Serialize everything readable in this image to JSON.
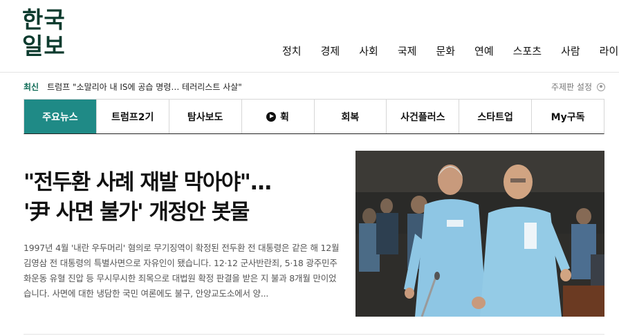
{
  "logo": {
    "line1": "한국",
    "line2": "일보"
  },
  "nav": {
    "items": [
      "정치",
      "경제",
      "사회",
      "국제",
      "문화",
      "연예",
      "스포츠",
      "사람",
      "라이"
    ]
  },
  "ticker": {
    "label": "최신",
    "headline": "트럼프 \"소말리아 내 IS에 공습 명령… 테러리스트 사살\""
  },
  "edition": {
    "label": "주제판 설정",
    "icon": "gear-icon"
  },
  "tabs": [
    {
      "label": "주요뉴스",
      "active": true
    },
    {
      "label": "트럼프2기"
    },
    {
      "label": "탐사보도"
    },
    {
      "label": "휙",
      "icon": "play-icon"
    },
    {
      "label": "회복"
    },
    {
      "label": "사건플러스"
    },
    {
      "label": "스타트업"
    },
    {
      "label": "My구독"
    }
  ],
  "article": {
    "headline_line1": "\"전두환 사례 재발 막아야\"...",
    "headline_line2": "'尹 사면 불가' 개정안 봇물",
    "summary": "1997년 4월 '내란 우두머리' 혐의로 무기징역이 확정된 전두환 전 대통령은 같은 해 12월 김영삼 전 대통령의 특별사면으로 자유인이 됐습니다. 12·12 군사반란죄, 5·18 광주민주화운동 유혈 진압 등 무시무시한 죄목으로 대법원 확정 판결을 받은 지 불과 8개월 만이었습니다. 사면에 대한 냉담한 국민 여론에도 불구, 안양교도소에서 양..."
  },
  "colors": {
    "accent": "#1f8a86",
    "logo": "#0c3b2e",
    "ticker_label": "#0e6b56"
  }
}
